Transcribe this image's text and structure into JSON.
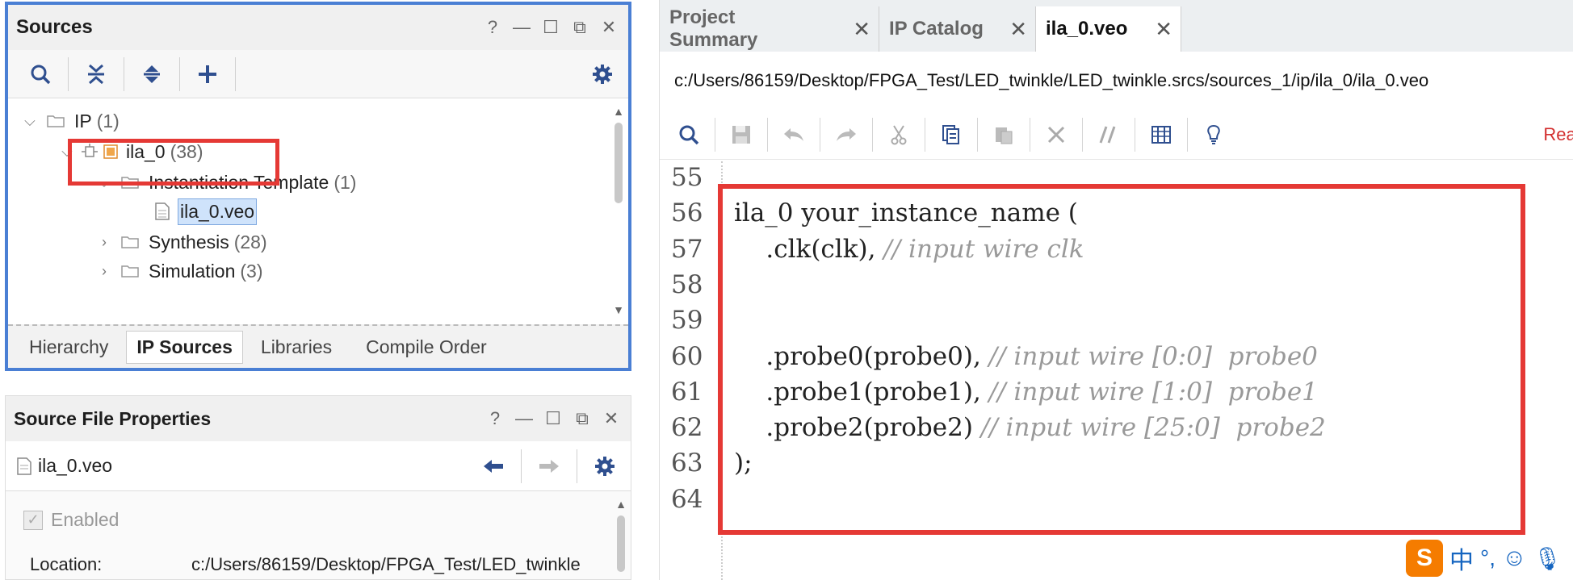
{
  "sources": {
    "title": "Sources",
    "win_controls": [
      "?",
      "—",
      "☐",
      "⧉",
      "✕"
    ],
    "toolbar": [
      {
        "icon": "search-icon"
      },
      {
        "icon": "collapse-all-icon"
      },
      {
        "icon": "expand-all-icon"
      },
      {
        "icon": "add-icon"
      },
      {
        "icon": "gear-icon"
      }
    ],
    "tree": {
      "ip": {
        "label": "IP",
        "count": "(1)"
      },
      "ila": {
        "label": "ila_0",
        "count": "(38)"
      },
      "inst": {
        "label": "Instantiation Template",
        "count": "(1)"
      },
      "veo": {
        "label": "ila_0.veo"
      },
      "synth": {
        "label": "Synthesis",
        "count": "(28)"
      },
      "sim": {
        "label": "Simulation",
        "count": "(3)"
      }
    },
    "tabs": [
      "Hierarchy",
      "IP Sources",
      "Libraries",
      "Compile Order"
    ],
    "active_tab": "IP Sources"
  },
  "props": {
    "title": "Source File Properties",
    "win_controls": [
      "?",
      "—",
      "☐",
      "⧉",
      "✕"
    ],
    "file": "ila_0.veo",
    "enabled_label": "Enabled",
    "location_label": "Location:",
    "location_value": "c:/Users/86159/Desktop/FPGA_Test/LED_twinkle"
  },
  "editor": {
    "tabs": [
      {
        "label": "Project Summary",
        "close": "✕"
      },
      {
        "label": "IP Catalog",
        "close": "✕"
      },
      {
        "label": "ila_0.veo",
        "close": "✕"
      }
    ],
    "active_tab": "ila_0.veo",
    "path": "c:/Users/86159/Desktop/FPGA_Test/LED_twinkle/LED_twinkle.srcs/sources_1/ip/ila_0/ila_0.veo",
    "read_label": "Read",
    "lines": [
      {
        "num": "55",
        "code": "",
        "comment": ""
      },
      {
        "num": "56",
        "code": "ila_0 your_instance_name (",
        "comment": ""
      },
      {
        "num": "57",
        "code": "    .clk(clk), ",
        "comment": "// input wire clk"
      },
      {
        "num": "58",
        "code": "",
        "comment": ""
      },
      {
        "num": "59",
        "code": "",
        "comment": ""
      },
      {
        "num": "60",
        "code": "    .probe0(probe0), ",
        "comment": "// input wire [0:0]  probe0"
      },
      {
        "num": "61",
        "code": "    .probe1(probe1), ",
        "comment": "// input wire [1:0]  probe1"
      },
      {
        "num": "62",
        "code": "    .probe2(probe2) ",
        "comment": "// input wire [25:0]  probe2"
      },
      {
        "num": "63",
        "code": ");",
        "comment": ""
      },
      {
        "num": "64",
        "code": "",
        "comment": ""
      }
    ]
  },
  "ime": {
    "label1": "中",
    "label2": "°,"
  },
  "colors": {
    "highlight_box": "#e53935",
    "panel_border": "#4a7fd4",
    "icon_blue": "#2f4f8f"
  }
}
